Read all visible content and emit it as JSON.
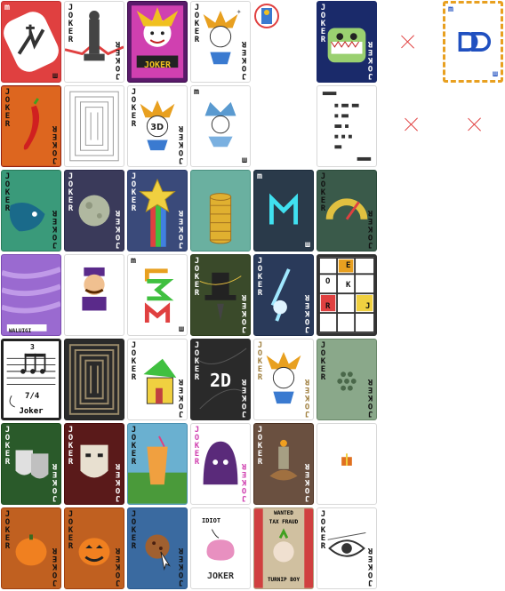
{
  "jokers": {
    "label": "JOKER",
    "mark_top": "m",
    "mark_bottom": "ш",
    "joker_logo_banner": "JOKER",
    "card_2d_text": "2D",
    "music_card_name": "Joker",
    "music_time_sig": "7/4",
    "music_note_count": "3",
    "mondrian_letters": [
      "O",
      "E",
      "K",
      "R",
      "J"
    ],
    "idiot_text": "IDIOT",
    "idiot_joker": "JOKER",
    "turnip_top": "WANTED",
    "turnip_mid": "TAX FRAUD",
    "turnip_bottom": "TURNIP BOY",
    "waluigi_tag": "WALUIGI"
  },
  "colors": {
    "accent_orange": "#e8a020",
    "x_red": "#e04040"
  }
}
